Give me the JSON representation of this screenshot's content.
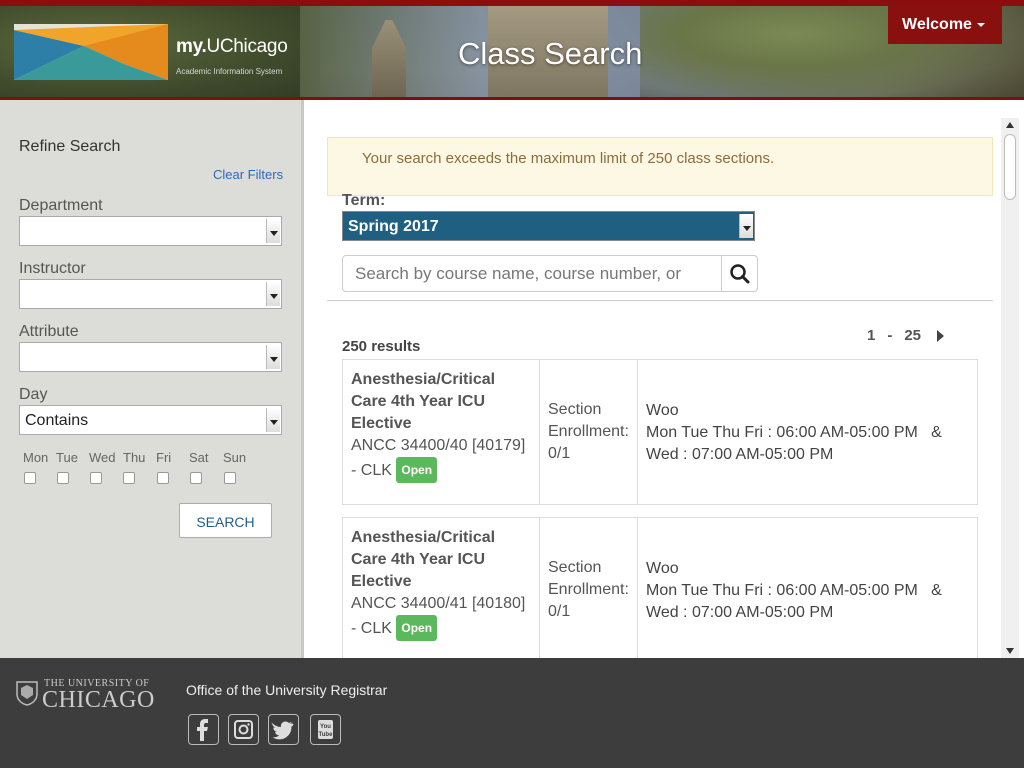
{
  "header": {
    "brand_prefix": "my.",
    "brand_name": "UChicago",
    "brand_sub": "Academic Information System",
    "page_title": "Class Search",
    "welcome_label": "Welcome"
  },
  "sidebar": {
    "refine_label": "Refine Search",
    "clear_label": "Clear Filters",
    "department_label": "Department",
    "department_value": "",
    "instructor_label": "Instructor",
    "instructor_value": "",
    "attribute_label": "Attribute",
    "attribute_value": "",
    "day_label": "Day",
    "day_value": "Contains",
    "days": [
      "Mon",
      "Tue",
      "Wed",
      "Thu",
      "Fri",
      "Sat",
      "Sun"
    ],
    "search_label": "SEARCH"
  },
  "main": {
    "alert": "Your search exceeds the maximum limit of 250 class sections.",
    "term_label": "Term:",
    "term_value": "Spring 2017",
    "search_placeholder": "Search by course name, course number, or",
    "results_count": "250 results",
    "pager_start": "1",
    "pager_sep": "-",
    "pager_end": "25",
    "cards": [
      {
        "title1": "Anesthesia/Critical",
        "title2": "Care 4th Year ICU",
        "title3": "Elective",
        "code": "ANCC 34400/40 [40179]",
        "location": "- CLK",
        "status": "Open",
        "enroll1": "Section",
        "enroll2": "Enrollment:",
        "enroll3": "0/1",
        "instructor": "Woo",
        "schedule1": "Mon Tue Thu Fri : 06:00 AM-05:00 PM   &",
        "schedule2": "Wed : 07:00 AM-05:00 PM"
      },
      {
        "title1": "Anesthesia/Critical",
        "title2": "Care 4th Year ICU",
        "title3": "Elective",
        "code": "ANCC 34400/41 [40180]",
        "location": "- CLK",
        "status": "Open",
        "enroll1": "Section",
        "enroll2": "Enrollment:",
        "enroll3": "0/1",
        "instructor": "Woo",
        "schedule1": "Mon Tue Thu Fri : 06:00 AM-05:00 PM   &",
        "schedule2": "Wed : 07:00 AM-05:00 PM"
      }
    ]
  },
  "footer": {
    "uc_small": "THE UNIVERSITY OF",
    "uc_big": "CHICAGO",
    "registrar": "Office of the University Registrar",
    "social": [
      "facebook-icon",
      "instagram-icon",
      "twitter-icon",
      "youtube-icon"
    ],
    "youtube_text": "You\nTube"
  },
  "colors": {
    "accent": "#8a0f0f",
    "term_bg": "#1f5f82",
    "open_badge": "#5cb85c",
    "link": "#2b6bb6"
  }
}
